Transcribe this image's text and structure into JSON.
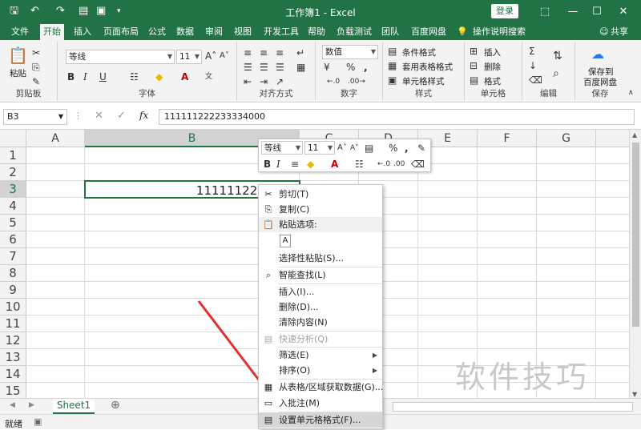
{
  "titlebar": {
    "title": "工作簿1  -  Excel",
    "login": "登录",
    "qa_icons": [
      "save-icon",
      "undo-icon",
      "redo-icon",
      "folder-open-icon",
      "print-preview-icon",
      "customize-qa-icon"
    ]
  },
  "tabs": [
    "文件",
    "开始",
    "插入",
    "页面布局",
    "公式",
    "数据",
    "审阅",
    "视图",
    "开发工具",
    "帮助",
    "负载测试",
    "团队",
    "百度网盘"
  ],
  "tellme": "操作说明搜索",
  "share": "共享",
  "ribbon": {
    "clipboard": {
      "paste": "粘贴",
      "label": "剪贴板"
    },
    "font": {
      "name": "等线",
      "size": "11",
      "label": "字体"
    },
    "align": {
      "label": "对齐方式"
    },
    "number": {
      "format": "数值",
      "label": "数字"
    },
    "styles": {
      "cond": "条件格式",
      "table": "套用表格格式",
      "cell": "单元格样式",
      "label": "样式"
    },
    "cells": {
      "insert": "插入",
      "delete": "删除",
      "format": "格式",
      "label": "单元格"
    },
    "edit": {
      "label": "编辑"
    },
    "save": {
      "line1": "保存到",
      "line2": "百度网盘",
      "label": "保存"
    }
  },
  "formula": {
    "namebox": "B3",
    "fx": "fx",
    "value": "111111222233334000"
  },
  "columns": [
    "A",
    "B",
    "C",
    "D",
    "E",
    "F",
    "G"
  ],
  "rows": [
    "1",
    "2",
    "3",
    "4",
    "5",
    "6",
    "7",
    "8",
    "9",
    "10",
    "11",
    "12",
    "13",
    "14",
    "15"
  ],
  "cell_b3": "1111112222333",
  "minitoolbar": {
    "font": "等线",
    "size": "11"
  },
  "context_menu": [
    {
      "label": "剪切(T)",
      "icon": "scissors-icon"
    },
    {
      "label": "复制(C)",
      "icon": "copy-icon"
    },
    {
      "label": "粘贴选项:",
      "icon": "paste-icon"
    },
    {
      "label": "",
      "icon": "paste-text-icon"
    },
    {
      "label": "选择性粘贴(S)...",
      "icon": ""
    },
    {
      "label": "智能查找(L)",
      "icon": "search-icon"
    },
    {
      "label": "插入(I)...",
      "icon": ""
    },
    {
      "label": "删除(D)...",
      "icon": ""
    },
    {
      "label": "清除内容(N)",
      "icon": ""
    },
    {
      "label": "快速分析(Q)",
      "icon": "quick-analysis-icon"
    },
    {
      "label": "筛选(E)",
      "icon": ""
    },
    {
      "label": "排序(O)",
      "icon": ""
    },
    {
      "label": "从表格/区域获取数据(G)...",
      "icon": "table-icon"
    },
    {
      "label": "入批注(M)",
      "icon": "comment-icon"
    },
    {
      "label": "设置单元格格式(F)...",
      "icon": "format-cells-icon"
    }
  ],
  "sheet": {
    "tab": "Sheet1"
  },
  "status": {
    "ready": "就绪"
  },
  "watermark": "软件技巧",
  "colors": {
    "excel_green": "#217346",
    "arrow": "#e03030"
  }
}
